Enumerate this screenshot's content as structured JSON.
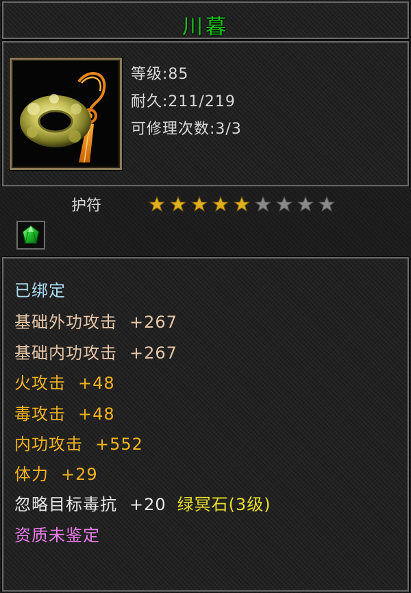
{
  "item": {
    "name": "川暮",
    "level_label": "等级",
    "level_value": ":85",
    "durability_label": "耐久",
    "durability_value": ":211/219",
    "repairs_label": "可修理次数",
    "repairs_value": ":3/3",
    "type": "护符",
    "stars_filled": 5,
    "stars_total": 9,
    "icon": "jade-amulet-icon",
    "gem_icon": "green-gem-icon"
  },
  "stats": {
    "bound": "已绑定",
    "lines": [
      {
        "label": "基础外功攻击",
        "value": "+267"
      },
      {
        "label": "基础内功攻击",
        "value": "+267"
      },
      {
        "label": "火攻击",
        "value": "+48"
      },
      {
        "label": "毒攻击",
        "value": "+48"
      },
      {
        "label": "内功攻击",
        "value": "+552"
      },
      {
        "label": "体力",
        "value": "+29"
      },
      {
        "label": "忽略目标毒抗",
        "value": "+20",
        "gem": "绿冥石(3级)"
      }
    ],
    "quality": "资质未鉴定"
  },
  "colors": {
    "title": "#19c219",
    "bound": "#a9dcf0",
    "base": "#e8c7a8",
    "gold": "#f2b21b",
    "gem_text": "#e8e02a",
    "quality": "#ea7cea",
    "star_on": "#e0b020",
    "star_off": "#8a8a8a"
  }
}
